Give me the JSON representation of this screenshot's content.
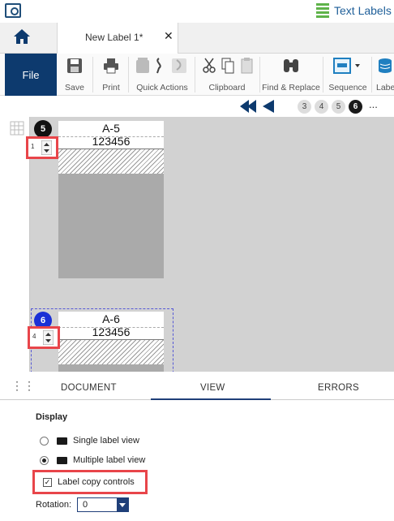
{
  "app": {
    "title": "Text Labels",
    "icon": "app-logo-icon",
    "title_icon": "text-labels-icon"
  },
  "tabs": {
    "home_icon": "home-icon",
    "doc_tab": "New Label 1*",
    "close_icon": "close-icon"
  },
  "ribbon": {
    "file": "File",
    "save": "Save",
    "print": "Print",
    "quick_actions": "Quick Actions",
    "clipboard": "Clipboard",
    "find_replace": "Find & Replace",
    "sequence": "Sequence",
    "label": "Labe"
  },
  "pager": {
    "pages": [
      "3",
      "4",
      "5",
      "6"
    ],
    "active": "6",
    "more": "..."
  },
  "labels": [
    {
      "badge": "5",
      "name": "A-5",
      "code": "123456",
      "copies": "1"
    },
    {
      "badge": "6",
      "name": "A-6",
      "code": "123456",
      "copies": "4"
    }
  ],
  "panel": {
    "tabs": [
      "DOCUMENT",
      "VIEW",
      "ERRORS"
    ],
    "active_tab": "VIEW",
    "display_title": "Display",
    "single_view": "Single label view",
    "multiple_view": "Multiple label view",
    "selected_view": "Multiple label view",
    "copy_controls": "Label copy controls",
    "copy_controls_checked": true,
    "rotation_label": "Rotation:",
    "rotation_value": "0"
  },
  "colors": {
    "brand": "#0d3a6e",
    "highlight": "#e8454a",
    "active_badge": "#1a30d6",
    "selection": "#5558d6"
  }
}
